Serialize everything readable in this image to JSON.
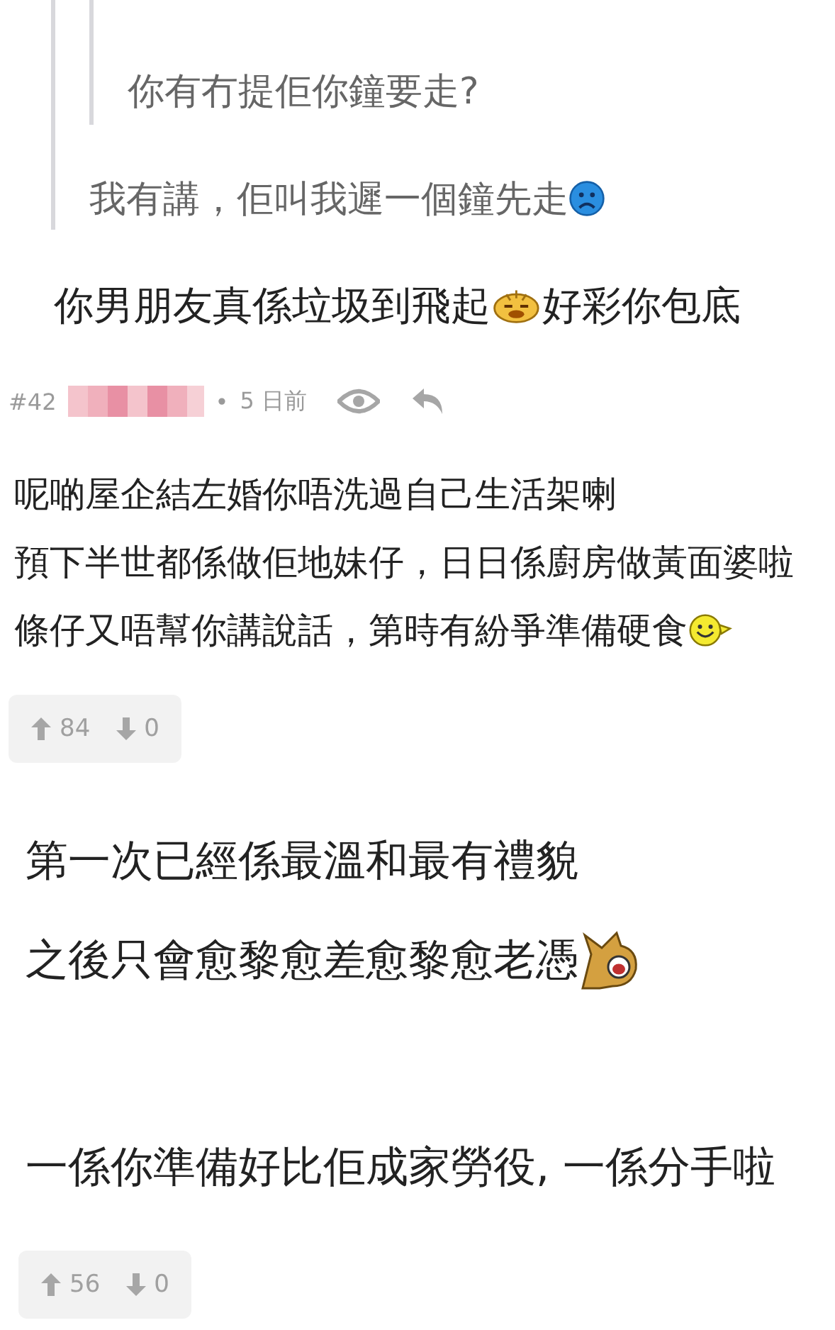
{
  "quote": {
    "quote": {
      "lines": [
        [
          {
            "kind": "text",
            "text": "你有冇提佢你鐘要走?"
          }
        ]
      ]
    },
    "lines": [
      [
        {
          "kind": "text",
          "text": "我有講，佢叫我遲一個鐘先走"
        },
        {
          "kind": "sad"
        }
      ]
    ]
  },
  "reply": {
    "lines": [
      [
        {
          "kind": "text",
          "text": "你男朋友真係垃圾到飛起"
        },
        {
          "kind": "frown"
        },
        {
          "kind": "text",
          "text": "好彩你包底"
        }
      ]
    ]
  },
  "posts": [
    {
      "number": "#42",
      "separator": "•",
      "time": "5 日前",
      "lines": [
        [
          {
            "kind": "text",
            "text": "呢啲屋企結左婚你唔洗過自己生活架喇"
          }
        ],
        [
          {
            "kind": "text",
            "text": "預下半世都係做佢地妹仔，日日係廚房做黃面婆啦"
          }
        ],
        [
          {
            "kind": "text",
            "text": "條仔又唔幫你講說話，第時有紛爭準備硬食"
          },
          {
            "kind": "smile"
          }
        ]
      ],
      "upvotes": "84",
      "downvotes": "0"
    },
    {
      "paragraphs": [
        [
          [
            {
              "kind": "text",
              "text": "第一次已經係最溫和最有禮貌"
            }
          ],
          [
            {
              "kind": "text",
              "text": "之後只會愈黎愈差愈黎愈老憑"
            },
            {
              "kind": "dog"
            }
          ]
        ],
        [
          [
            {
              "kind": "text",
              "text": "一係你準備好比佢成家勞役, 一係分手啦"
            }
          ]
        ]
      ],
      "upvotes": "56",
      "downvotes": "0"
    }
  ]
}
